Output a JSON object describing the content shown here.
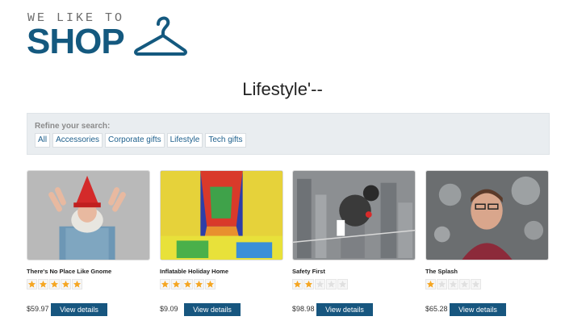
{
  "header": {
    "logo_top": "WE LIKE TO",
    "logo_main": "SHOP",
    "logo_icon": "hanger-icon"
  },
  "page_title": "Lifestyle'--",
  "filter": {
    "label": "Refine your search:",
    "links": [
      "All",
      "Accessories",
      "Corporate gifts",
      "Lifestyle",
      "Tech gifts"
    ]
  },
  "products": [
    {
      "name": "There's No Place Like Gnome",
      "rating": 5,
      "price": "$59.97",
      "button": "View details",
      "image": "gnome-hat-man-image"
    },
    {
      "name": "Inflatable Holiday Home",
      "rating": 5,
      "price": "$9.09",
      "button": "View details",
      "image": "bouncy-castle-image"
    },
    {
      "name": "Safety First",
      "rating": 2,
      "price": "$98.98",
      "button": "View details",
      "image": "tightrope-city-image"
    },
    {
      "name": "The Splash",
      "rating": 1,
      "price": "$65.28",
      "button": "View details",
      "image": "water-splash-face-image"
    }
  ],
  "colors": {
    "brand": "#14597f",
    "button": "#17567f",
    "star_filled": "#f5a623",
    "star_empty": "#e0e0e0",
    "filter_bg": "#e9edf0"
  }
}
